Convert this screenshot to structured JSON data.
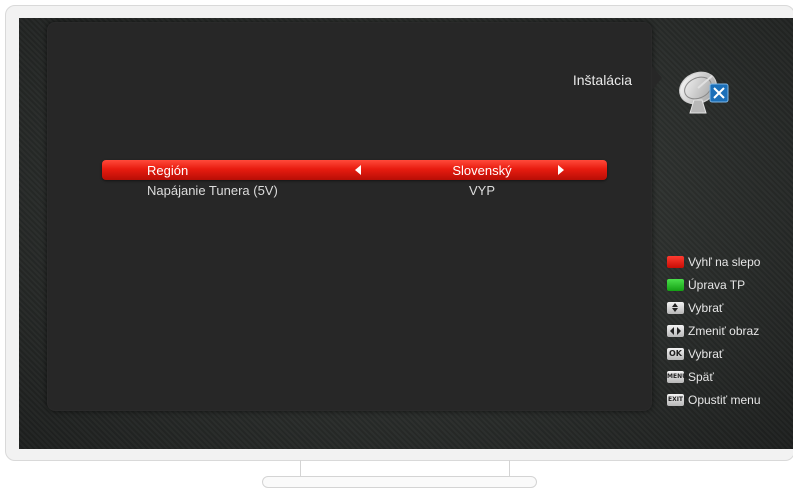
{
  "header": {
    "title": "Inštalácia",
    "icon": "satellite-dish-icon"
  },
  "menu": {
    "rows": [
      {
        "label": "Región",
        "value": "Slovenský",
        "selected": true
      },
      {
        "label": "Napájanie Tunera (5V)",
        "value": "VYP",
        "selected": false
      }
    ]
  },
  "help": {
    "items": [
      {
        "key": "red",
        "label": "Vyhľ na slepo"
      },
      {
        "key": "green",
        "label": "Úprava TP"
      },
      {
        "key": "up-down",
        "label": "Vybrať"
      },
      {
        "key": "left-right",
        "label": "Zmeniť obraz"
      },
      {
        "key": "ok",
        "key_text": "OK",
        "label": "Vybrať"
      },
      {
        "key": "menu",
        "key_text": "MENU",
        "label": "Späť"
      },
      {
        "key": "exit",
        "key_text": "EXIT",
        "label": "Opustiť menu"
      }
    ]
  },
  "colors": {
    "selection": "#e81c10",
    "panel": "#272727",
    "background": "#2b2e2c",
    "red_key": "#ff3b30",
    "green_key": "#14a014"
  }
}
